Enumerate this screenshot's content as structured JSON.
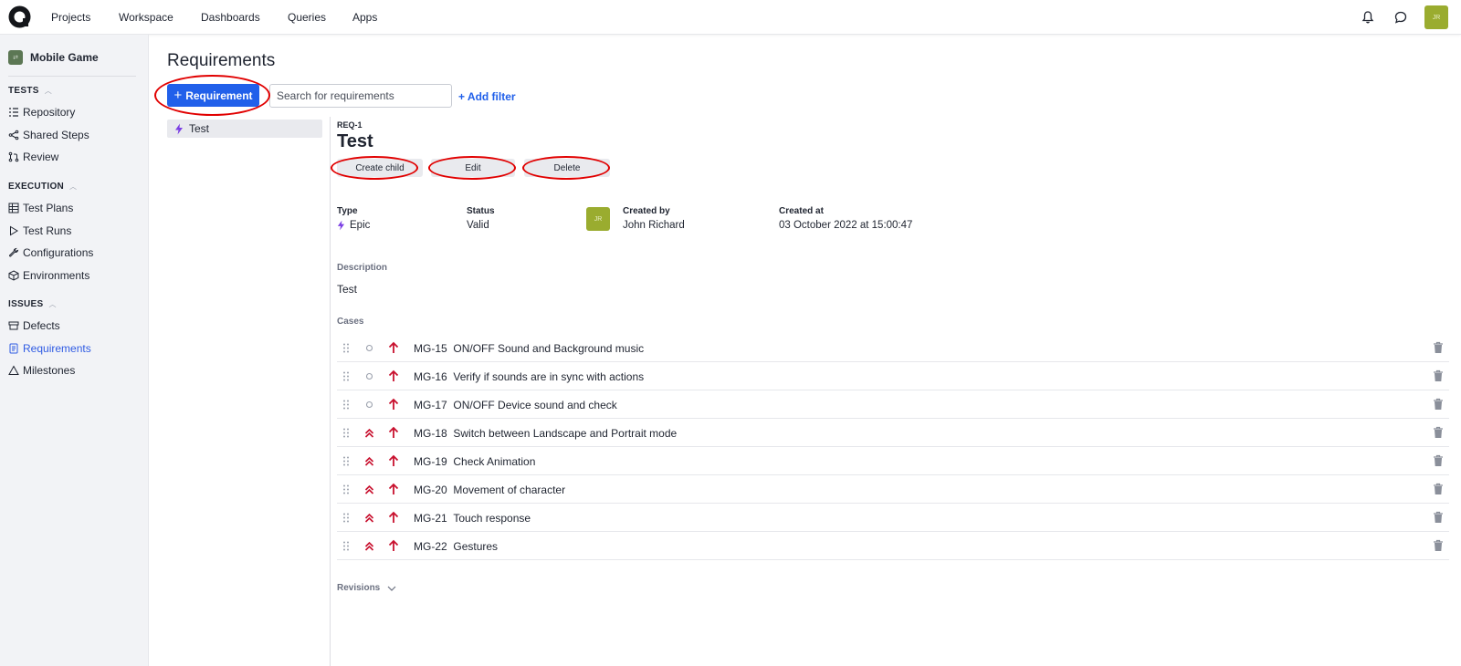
{
  "topnav": {
    "items": [
      "Projects",
      "Workspace",
      "Dashboards",
      "Queries",
      "Apps"
    ],
    "avatar": "JR"
  },
  "sidebar": {
    "project": {
      "name": "Mobile Game",
      "icon_text": "⇄"
    },
    "sections": [
      {
        "title": "TESTS",
        "items": [
          "Repository",
          "Shared Steps",
          "Review"
        ]
      },
      {
        "title": "EXECUTION",
        "items": [
          "Test Plans",
          "Test Runs",
          "Configurations",
          "Environments"
        ]
      },
      {
        "title": "ISSUES",
        "items": [
          "Defects",
          "Requirements",
          "Milestones"
        ]
      }
    ],
    "active": "Requirements"
  },
  "main": {
    "title": "Requirements",
    "add_button": "Requirement",
    "search_placeholder": "Search for requirements",
    "add_filter": "+ Add filter",
    "tree": [
      {
        "label": "Test",
        "icon": "bolt-icon"
      }
    ]
  },
  "detail": {
    "id": "REQ-1",
    "title": "Test",
    "actions": [
      "Create child",
      "Edit",
      "Delete"
    ],
    "meta": {
      "type_label": "Type",
      "type_value": "Epic",
      "status_label": "Status",
      "status_value": "Valid",
      "created_by_label": "Created by",
      "created_by_value": "John Richard",
      "created_by_avatar": "JR",
      "created_at_label": "Created at",
      "created_at_value": "03 October 2022 at 15:00:47"
    },
    "description_label": "Description",
    "description": "Test",
    "cases_label": "Cases",
    "cases": [
      {
        "id": "MG-15",
        "title": "ON/OFF Sound and Background music",
        "severity": "not-set"
      },
      {
        "id": "MG-16",
        "title": "Verify if sounds are in sync with actions",
        "severity": "not-set"
      },
      {
        "id": "MG-17",
        "title": "ON/OFF Device sound and check",
        "severity": "not-set"
      },
      {
        "id": "MG-18",
        "title": "Switch between Landscape and Portrait mode",
        "severity": "critical"
      },
      {
        "id": "MG-19",
        "title": "Check Animation",
        "severity": "critical"
      },
      {
        "id": "MG-20",
        "title": "Movement of character",
        "severity": "critical"
      },
      {
        "id": "MG-21",
        "title": "Touch response",
        "severity": "critical"
      },
      {
        "id": "MG-22",
        "title": "Gestures",
        "severity": "critical"
      }
    ],
    "revisions_label": "Revisions"
  },
  "colors": {
    "accent": "#2160ea",
    "priority": "#c8102e",
    "annotation": "#e10000",
    "avatar": "#9aac2f"
  }
}
